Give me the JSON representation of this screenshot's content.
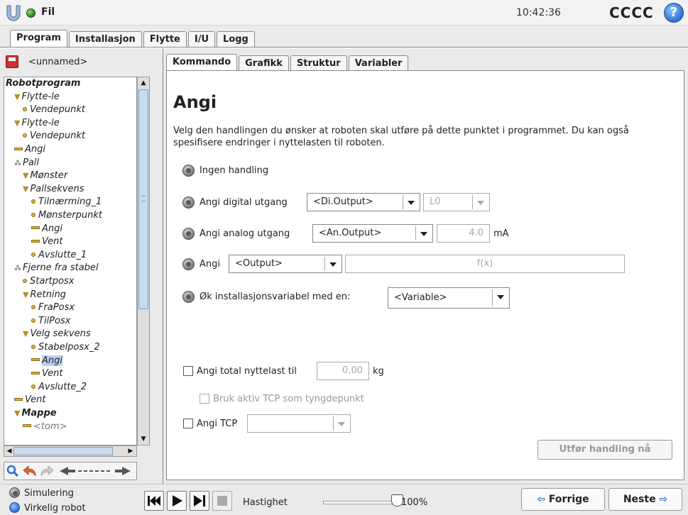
{
  "header": {
    "file_label": "Fil",
    "time": "10:42:36",
    "robot_name": "CCCC",
    "help_symbol": "?"
  },
  "main_tabs": [
    {
      "label": "Program",
      "active": true
    },
    {
      "label": "Installasjon",
      "active": false
    },
    {
      "label": "Flytte",
      "active": false
    },
    {
      "label": "I/U",
      "active": false
    },
    {
      "label": "Logg",
      "active": false
    }
  ],
  "program": {
    "name": "<unnamed>",
    "tree": [
      {
        "label": "Robotprogram",
        "depth": 0,
        "icon": "none",
        "bold": true
      },
      {
        "label": "Flytte-le",
        "depth": 1,
        "icon": "triangle"
      },
      {
        "label": "Vendepunkt",
        "depth": 2,
        "icon": "dot"
      },
      {
        "label": "Flytte-le",
        "depth": 1,
        "icon": "triangle"
      },
      {
        "label": "Vendepunkt",
        "depth": 2,
        "icon": "dot"
      },
      {
        "label": "Angi",
        "depth": 1,
        "icon": "bar"
      },
      {
        "label": "Pall",
        "depth": 1,
        "icon": "cluster"
      },
      {
        "label": "Mønster",
        "depth": 2,
        "icon": "triangle"
      },
      {
        "label": "Pallsekvens",
        "depth": 2,
        "icon": "triangle"
      },
      {
        "label": "Tilnærming_1",
        "depth": 3,
        "icon": "dot"
      },
      {
        "label": "Mønsterpunkt",
        "depth": 3,
        "icon": "dot"
      },
      {
        "label": "Angi",
        "depth": 3,
        "icon": "bar"
      },
      {
        "label": "Vent",
        "depth": 3,
        "icon": "bar"
      },
      {
        "label": "Avslutte_1",
        "depth": 3,
        "icon": "dot"
      },
      {
        "label": "Fjerne fra stabel",
        "depth": 1,
        "icon": "cluster"
      },
      {
        "label": "Startposx",
        "depth": 2,
        "icon": "dot"
      },
      {
        "label": "Retning",
        "depth": 2,
        "icon": "triangle"
      },
      {
        "label": "FraPosx",
        "depth": 3,
        "icon": "dot"
      },
      {
        "label": "TilPosx",
        "depth": 3,
        "icon": "dot"
      },
      {
        "label": "Velg sekvens",
        "depth": 2,
        "icon": "triangle"
      },
      {
        "label": "Stabelposx_2",
        "depth": 3,
        "icon": "dot"
      },
      {
        "label": "Angi",
        "depth": 3,
        "icon": "bar",
        "selected": true
      },
      {
        "label": "Vent",
        "depth": 3,
        "icon": "bar"
      },
      {
        "label": "Avslutte_2",
        "depth": 3,
        "icon": "dot"
      },
      {
        "label": "Vent",
        "depth": 1,
        "icon": "bar"
      },
      {
        "label": "Mappe",
        "depth": 1,
        "icon": "triangle",
        "bold": true
      },
      {
        "label": "<tom>",
        "depth": 2,
        "icon": "bar",
        "muted": true
      }
    ]
  },
  "sub_tabs": [
    {
      "label": "Kommando",
      "active": true
    },
    {
      "label": "Grafikk",
      "active": false
    },
    {
      "label": "Struktur",
      "active": false
    },
    {
      "label": "Variabler",
      "active": false
    }
  ],
  "command": {
    "title": "Angi",
    "description": "Velg den handlingen du ønsker at roboten skal utføre på dette punktet i programmet. Du kan også spesifisere endringer i nyttelasten til roboten.",
    "options": {
      "no_action": "Ingen handling",
      "digital_out": "Angi digital utgang",
      "digital_combo": "<Di.Output>",
      "digital_value": "L0",
      "analog_out": "Angi analog utgang",
      "analog_combo": "<An.Output>",
      "analog_value": "4.0",
      "analog_unit": "mA",
      "set": "Angi",
      "set_combo": "<Output>",
      "set_expr": "f(x)",
      "increment": "Øk installasjonsvariabel med en:",
      "increment_combo": "<Variable>"
    },
    "payload_label": "Angi total nyttelast til",
    "payload_value": "0,00",
    "payload_unit": "kg",
    "tcp_cog_label": "Bruk aktiv TCP som tyngdepunkt",
    "tcp_label": "Angi TCP",
    "run_now": "Utfør handling nå"
  },
  "footer": {
    "simulation": "Simulering",
    "real_robot": "Virkelig robot",
    "speed_label": "Hastighet",
    "speed_value": "100%",
    "speed_fraction": 1.0,
    "prev": "Forrige",
    "next": "Neste"
  },
  "colors": {
    "accent_blue": "#2b6fd1",
    "status_green": "#2e8b22",
    "selection": "#b7d2f0",
    "node_yellow": "#d8b03a"
  }
}
